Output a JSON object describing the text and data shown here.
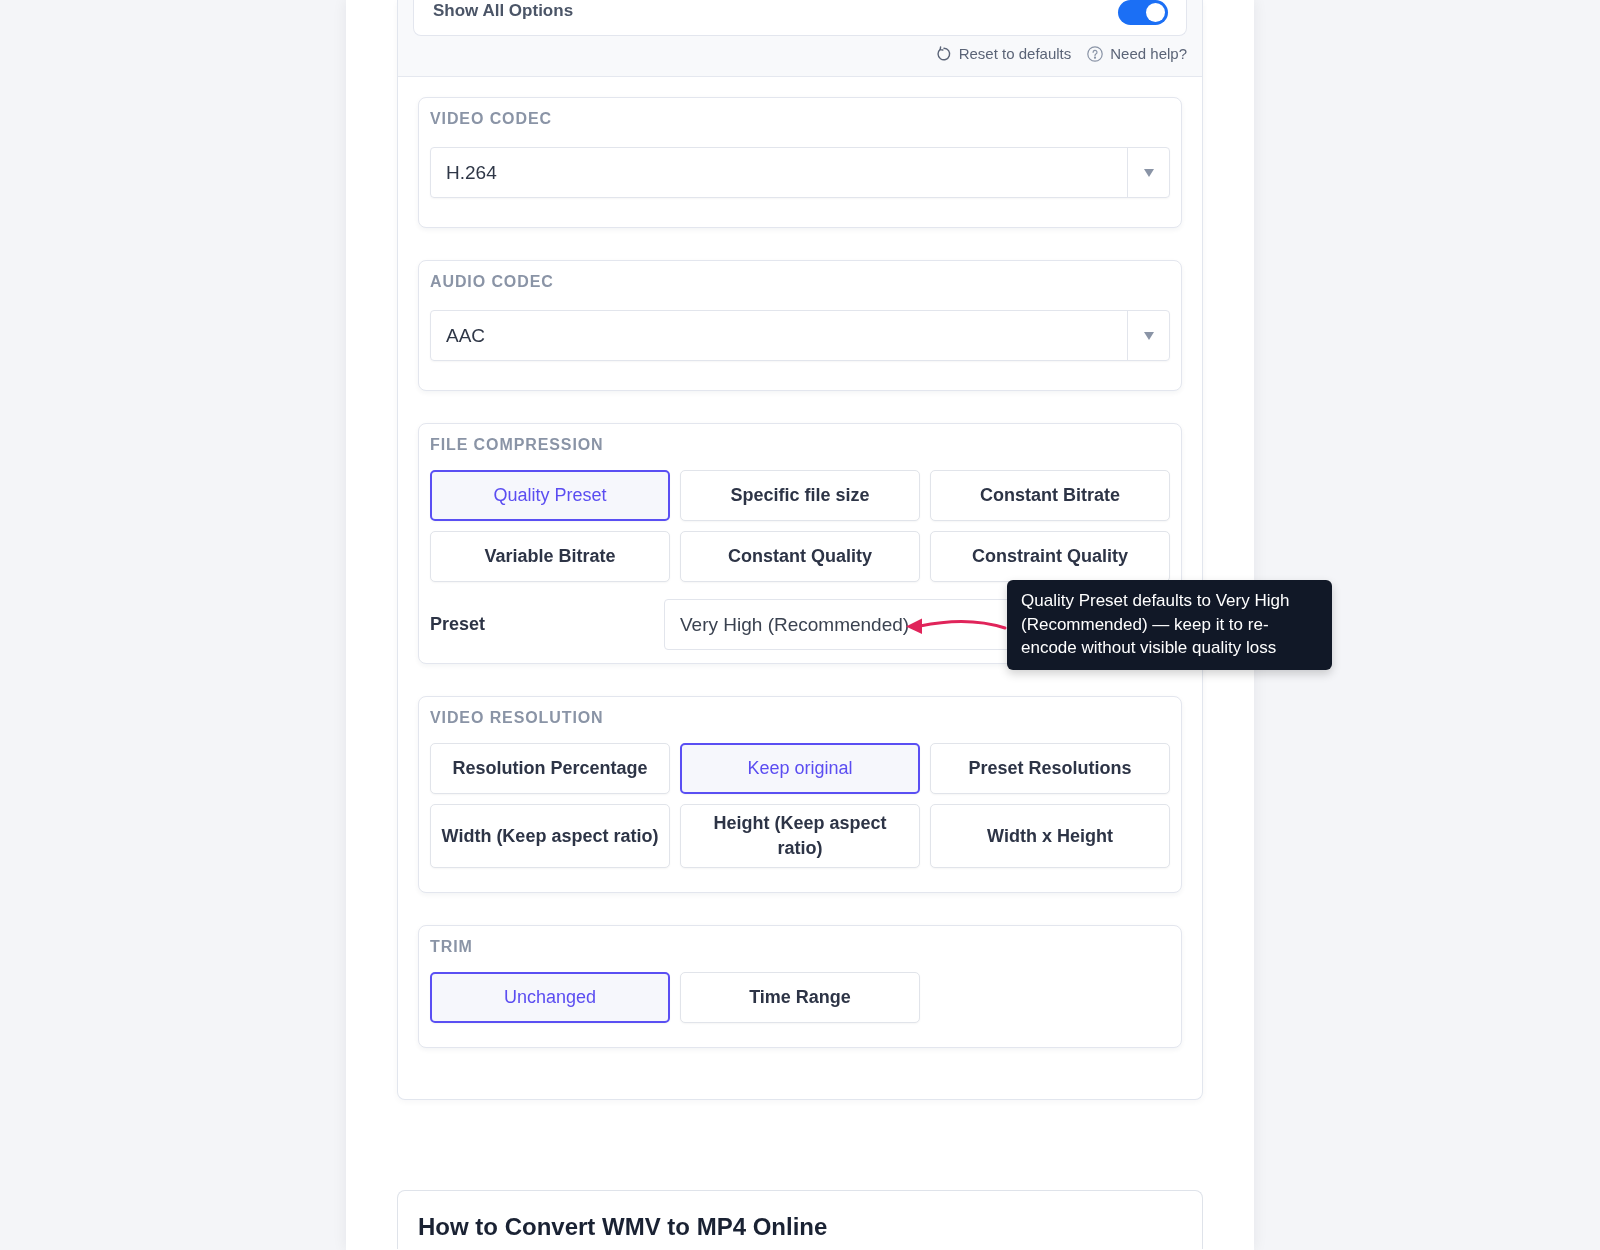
{
  "options_panel": {
    "show_all_options": {
      "label": "Show All Options",
      "on": true
    },
    "links": [
      {
        "kind": "reset",
        "label": "Reset to defaults"
      },
      {
        "kind": "help",
        "label": "Need help?"
      }
    ],
    "sections": [
      {
        "kind": "select",
        "title": "VIDEO CODEC",
        "value": "H.264"
      },
      {
        "kind": "select",
        "title": "AUDIO CODEC",
        "value": "AAC"
      },
      {
        "kind": "options",
        "title": "FILE COMPRESSION",
        "options": [
          {
            "label": "Quality Preset",
            "selected": true
          },
          {
            "label": "Specific file size",
            "selected": false
          },
          {
            "label": "Constant Bitrate",
            "selected": false
          },
          {
            "label": "Variable Bitrate",
            "selected": false
          },
          {
            "label": "Constant Quality",
            "selected": false
          },
          {
            "label": "Constraint Quality",
            "selected": false
          }
        ],
        "field": {
          "label": "Preset",
          "value": "Very High (Recommended)"
        },
        "tooltip": {
          "text": "Quality Preset defaults to Very High (Recommended) — keep it to re-encode without visible quality loss"
        }
      },
      {
        "kind": "options",
        "title": "VIDEO RESOLUTION",
        "options": [
          {
            "label": "Resolution Percentage",
            "selected": false
          },
          {
            "label": "Keep original",
            "selected": true
          },
          {
            "label": "Preset Resolutions",
            "selected": false
          },
          {
            "label": "Width (Keep aspect ratio)",
            "selected": false
          },
          {
            "label": "Height (Keep aspect ratio)",
            "selected": false
          },
          {
            "label": "Width x Height",
            "selected": false
          }
        ]
      },
      {
        "kind": "options",
        "title": "TRIM",
        "options": [
          {
            "label": "Unchanged",
            "selected": true
          },
          {
            "label": "Time Range",
            "selected": false
          }
        ]
      }
    ]
  },
  "article": {
    "heading": "How to Convert WMV to MP4 Online"
  }
}
